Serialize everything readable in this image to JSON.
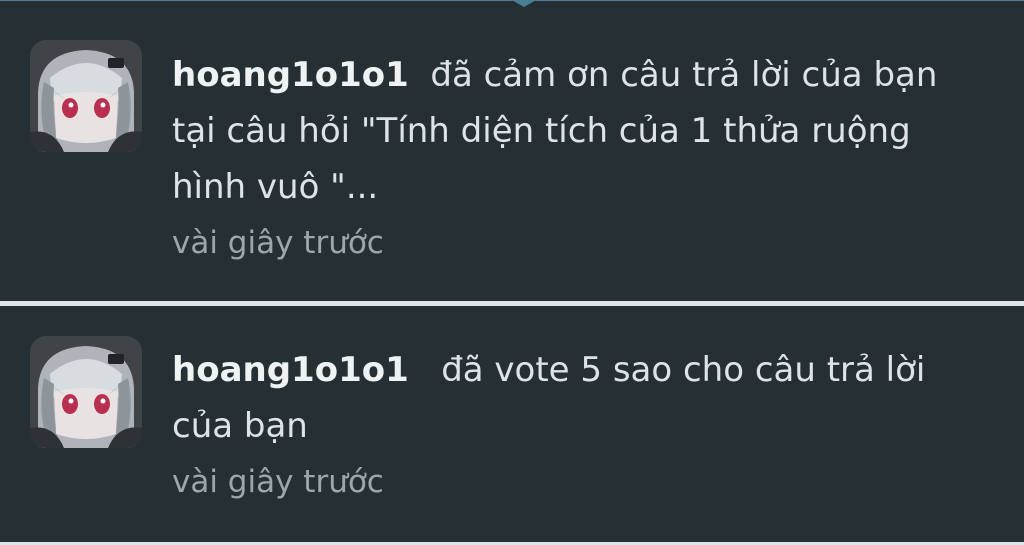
{
  "notifications": [
    {
      "username": "hoang1o1o1",
      "action": "đã cảm ơn câu trả lời của bạn tại câu hỏi \"Tính diện tích của 1 thửa ruộng hình vuô \"...",
      "time": "vài giây trước",
      "avatar_icon": "anime-avatar-icon"
    },
    {
      "username": "hoang1o1o1",
      "action": "đã vote 5 sao cho câu trả lời của bạn",
      "time": "vài giây trước",
      "avatar_icon": "anime-avatar-icon"
    }
  ],
  "colors": {
    "panel_bg": "#263034",
    "text": "#dde3e6",
    "muted_text": "#9ba7ab",
    "divider": "#dfe5e6",
    "accent_edge": "#4a7f97"
  }
}
